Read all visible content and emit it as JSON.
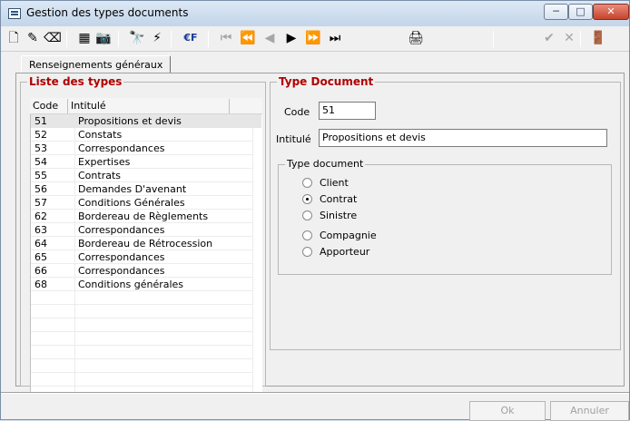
{
  "window": {
    "title": "Gestion des types documents",
    "buttons": {
      "min": "─",
      "max": "□",
      "close": "✕"
    }
  },
  "toolbar": {
    "new_icon": "🗋",
    "edit_icon": "✎",
    "erase_icon": "⌫",
    "grid_icon": "▦",
    "camera_icon": "📷",
    "binoculars_icon": "🔭",
    "lightning_icon": "⚡",
    "currency_label": "€F",
    "first_icon": "⏮",
    "fast_prev_icon": "⏪",
    "prev_icon": "◀",
    "next_icon": "▶",
    "fast_next_icon": "⏩",
    "last_icon": "⏭",
    "print_icon": "🖨",
    "validate_icon": "✔",
    "cancel_icon": "✕",
    "exit_icon": "🚪"
  },
  "tab": {
    "label": "Renseignements généraux"
  },
  "list": {
    "title": "Liste des types",
    "headers": {
      "code": "Code",
      "title": "Intitulé"
    },
    "rows": [
      {
        "code": "51",
        "title": "Propositions et devis"
      },
      {
        "code": "52",
        "title": "Constats"
      },
      {
        "code": "53",
        "title": "Correspondances"
      },
      {
        "code": "54",
        "title": "Expertises"
      },
      {
        "code": "55",
        "title": "Contrats"
      },
      {
        "code": "56",
        "title": "Demandes D'avenant"
      },
      {
        "code": "57",
        "title": "Conditions Générales"
      },
      {
        "code": "62",
        "title": "Bordereau de Règlements"
      },
      {
        "code": "63",
        "title": "Correspondances"
      },
      {
        "code": "64",
        "title": "Bordereau de Rétrocession"
      },
      {
        "code": "65",
        "title": "Correspondances"
      },
      {
        "code": "66",
        "title": "Correspondances"
      },
      {
        "code": "68",
        "title": "Conditions générales"
      }
    ]
  },
  "detail": {
    "title": "Type Document",
    "code_label": "Code",
    "code_value": "51",
    "title_label": "Intitulé",
    "title_value": "Propositions et devis",
    "type_group_label": "Type document",
    "options": [
      {
        "label": "Client",
        "checked": false
      },
      {
        "label": "Contrat",
        "checked": true
      },
      {
        "label": "Sinistre",
        "checked": false
      },
      {
        "label": "Compagnie",
        "checked": false
      },
      {
        "label": "Apporteur",
        "checked": false
      }
    ]
  },
  "buttons": {
    "ok": "Ok",
    "cancel": "Annuler"
  }
}
